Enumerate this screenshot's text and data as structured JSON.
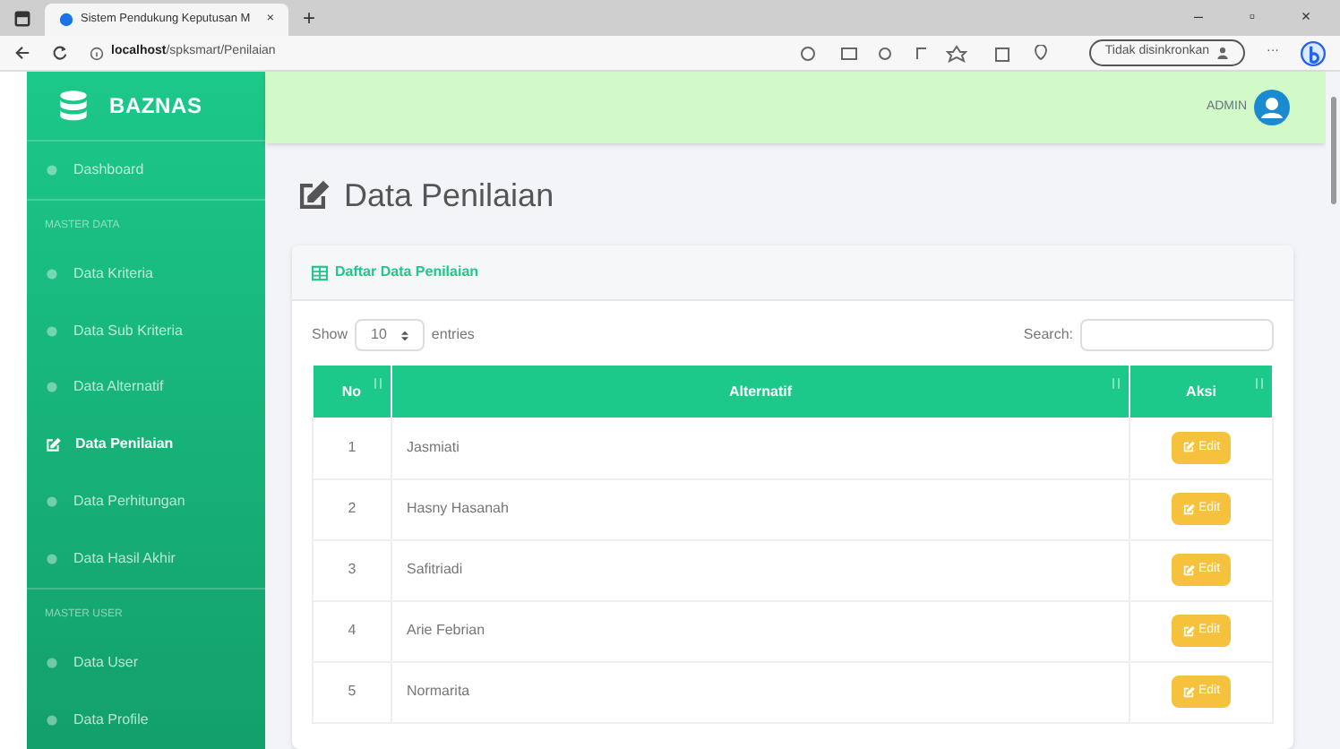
{
  "browser": {
    "tab_title": "Sistem Pendukung Keputusan M",
    "tab_close": "×",
    "new_tab": "+",
    "url_host": "localhost",
    "url_path": "/spksmart/Penilaian",
    "sync_button": "Tidak disinkronkan",
    "more": "···",
    "window_controls": [
      "–",
      "▫",
      "×"
    ]
  },
  "sidebar": {
    "brand": "BAZNAS",
    "items": [
      {
        "kind": "link",
        "label": "Dashboard",
        "selected": false
      },
      {
        "kind": "heading",
        "label": "MASTER DATA"
      },
      {
        "kind": "link",
        "label": "Data Kriteria",
        "selected": false
      },
      {
        "kind": "link",
        "label": "Data Sub Kriteria",
        "selected": false
      },
      {
        "kind": "link",
        "label": "Data Alternatif",
        "selected": false
      },
      {
        "kind": "link",
        "label": "Data Penilaian",
        "selected": true
      },
      {
        "kind": "link",
        "label": "Data Perhitungan",
        "selected": false
      },
      {
        "kind": "link",
        "label": "Data Hasil Akhir",
        "selected": false
      },
      {
        "kind": "heading",
        "label": "MASTER USER"
      },
      {
        "kind": "link",
        "label": "Data User",
        "selected": false
      },
      {
        "kind": "link",
        "label": "Data Profile",
        "selected": false
      }
    ]
  },
  "topbar": {
    "user": "ADMIN"
  },
  "page_title": "Data Penilaian",
  "card": {
    "title": "Daftar Data Penilaian",
    "show_label": "Show",
    "entries_value": "10",
    "entries_label": "entries",
    "search_label": "Search:",
    "table": {
      "columns": [
        "No",
        "Alternatif",
        "Aksi"
      ],
      "rows": [
        {
          "no": "1",
          "alternatif": "Jasmiati",
          "action": "Edit"
        },
        {
          "no": "2",
          "alternatif": "Hasny Hasanah",
          "action": "Edit"
        },
        {
          "no": "3",
          "alternatif": "Safitriadi",
          "action": "Edit"
        },
        {
          "no": "4",
          "alternatif": "Arie Febrian",
          "action": "Edit"
        },
        {
          "no": "5",
          "alternatif": "Normarita",
          "action": "Edit"
        }
      ]
    }
  }
}
